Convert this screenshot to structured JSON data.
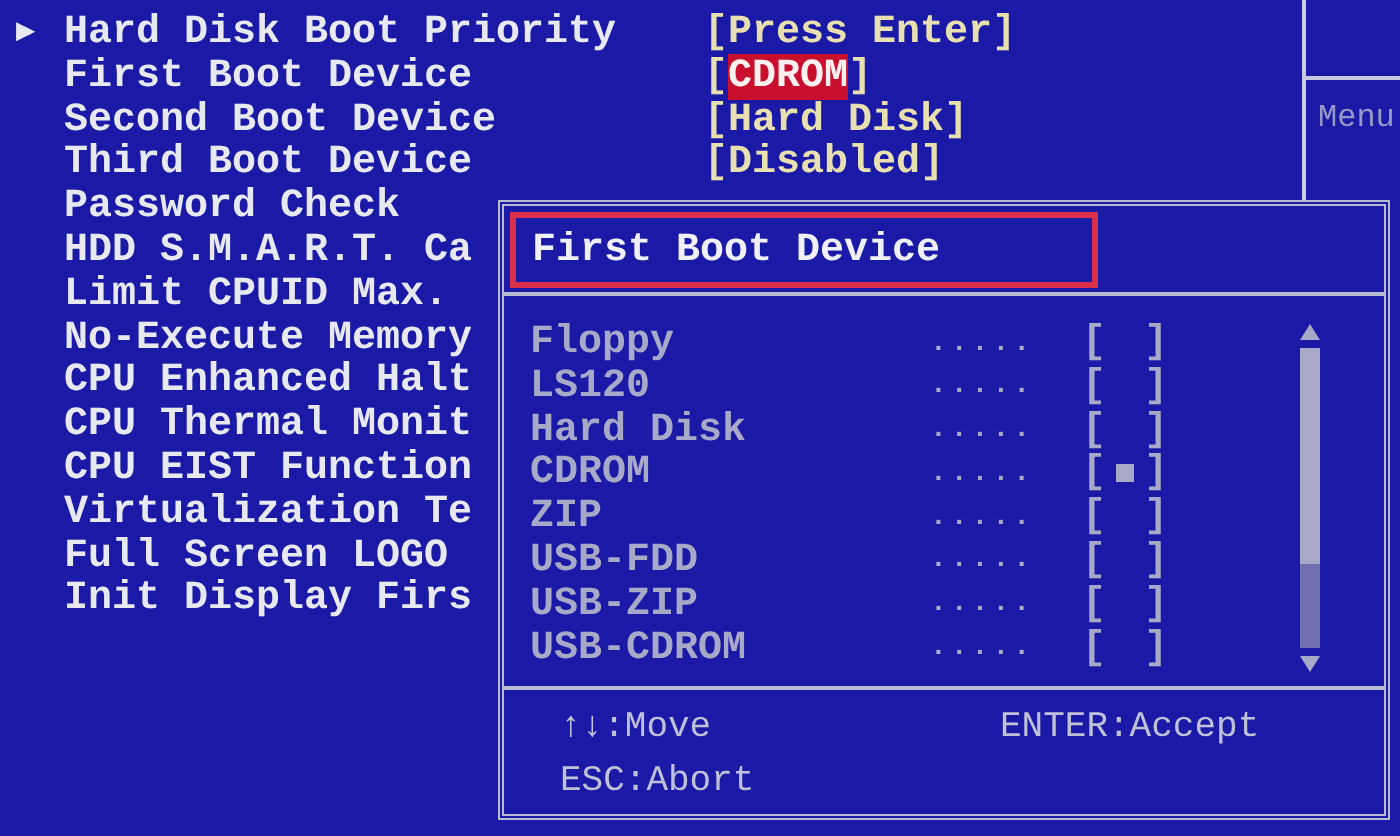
{
  "settings": [
    {
      "name": "Hard Disk Boot Priority",
      "kind": "submenu",
      "marker": "▶",
      "selected": false,
      "value_parts": [
        "[",
        "Press Enter",
        "]"
      ]
    },
    {
      "name": "First Boot Device",
      "kind": "setting",
      "selected": true,
      "value_parts": [
        "[",
        "CDROM",
        "]"
      ]
    },
    {
      "name": "Second Boot Device",
      "kind": "setting",
      "selected": false,
      "value_parts": [
        "[",
        "Hard Disk",
        "]"
      ]
    },
    {
      "name": "Third Boot Device",
      "kind": "setting",
      "selected": false,
      "value_parts": [
        "[",
        "Disabled",
        "]"
      ]
    },
    {
      "name": "Password Check",
      "kind": "setting",
      "selected": false
    },
    {
      "name": "HDD S.M.A.R.T. Ca",
      "kind": "setting",
      "selected": false
    },
    {
      "name": "Limit CPUID Max.",
      "kind": "setting",
      "selected": false
    },
    {
      "name": "No-Execute Memory",
      "kind": "setting",
      "selected": false
    },
    {
      "name": "CPU Enhanced Halt",
      "kind": "setting",
      "selected": false
    },
    {
      "name": "CPU Thermal Monit",
      "kind": "setting",
      "selected": false
    },
    {
      "name": "CPU EIST Function",
      "kind": "setting",
      "selected": false
    },
    {
      "name": "Virtualization Te",
      "kind": "setting",
      "selected": false
    },
    {
      "name": "Full Screen LOGO",
      "kind": "setting",
      "selected": false
    },
    {
      "name": "Init Display Firs",
      "kind": "setting",
      "selected": false
    }
  ],
  "help_pane": {
    "title": "Menu"
  },
  "dialog": {
    "title": "First Boot Device",
    "options": [
      {
        "name": "Floppy",
        "leader": ".....",
        "box_open": "[",
        "box_close": "]",
        "checked": false
      },
      {
        "name": "LS120",
        "leader": ".....",
        "box_open": "[",
        "box_close": "]",
        "checked": false
      },
      {
        "name": "Hard Disk",
        "leader": ".....",
        "box_open": "[",
        "box_close": "]",
        "checked": false
      },
      {
        "name": "CDROM",
        "leader": ".....",
        "box_open": "[",
        "box_close": "]",
        "checked": true
      },
      {
        "name": "ZIP",
        "leader": ".....",
        "box_open": "[",
        "box_close": "]",
        "checked": false
      },
      {
        "name": "USB-FDD",
        "leader": ".....",
        "box_open": "[",
        "box_close": "]",
        "checked": false
      },
      {
        "name": "USB-ZIP",
        "leader": ".....",
        "box_open": "[",
        "box_close": "]",
        "checked": false
      },
      {
        "name": "USB-CDROM",
        "leader": ".....",
        "box_open": "[",
        "box_close": "]",
        "checked": false
      }
    ],
    "keys": [
      "↑↓:Move",
      "ENTER:Accept",
      "ESC:Abort"
    ]
  }
}
